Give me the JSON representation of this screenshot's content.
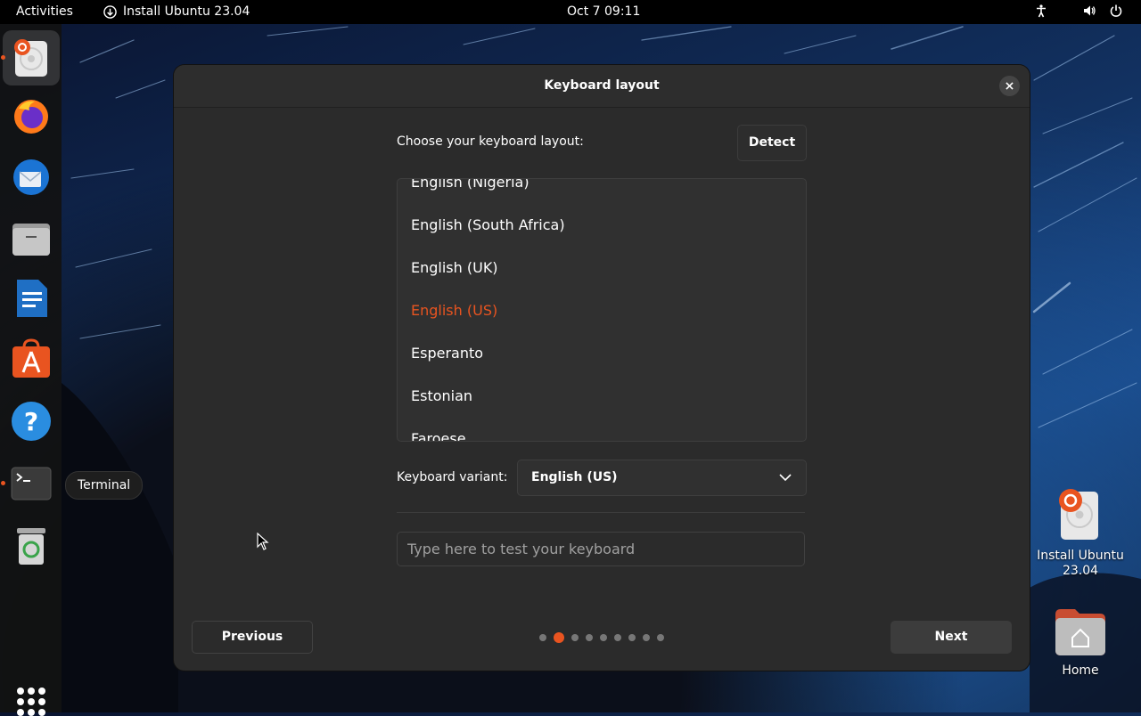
{
  "topbar": {
    "activities": "Activities",
    "app_name": "Install Ubuntu 23.04",
    "clock": "Oct 7  09:11",
    "tray_icons": [
      "accessibility-icon",
      "volume-icon",
      "power-icon"
    ]
  },
  "dock": {
    "items": [
      {
        "name": "ubuntu-installer",
        "running": true,
        "active": true
      },
      {
        "name": "firefox"
      },
      {
        "name": "thunderbird"
      },
      {
        "name": "files"
      },
      {
        "name": "libreoffice-writer"
      },
      {
        "name": "ubuntu-software"
      },
      {
        "name": "help"
      },
      {
        "name": "terminal",
        "running": true
      },
      {
        "name": "trash"
      }
    ],
    "tooltip": "Terminal",
    "show_apps_icon": "apps-grid-icon"
  },
  "dialog": {
    "title": "Keyboard layout",
    "choose_label": "Choose your keyboard layout:",
    "detect_label": "Detect",
    "layouts": [
      "English (Nigeria)",
      "English (South Africa)",
      "English (UK)",
      "English (US)",
      "Esperanto",
      "Estonian",
      "Faroese"
    ],
    "selected_layout": "English (US)",
    "variant_label": "Keyboard variant:",
    "variant_value": "English (US)",
    "test_placeholder": "Type here to test your keyboard",
    "previous_label": "Previous",
    "next_label": "Next",
    "progress": {
      "total": 9,
      "current": 2
    }
  },
  "desktop": {
    "icons": [
      {
        "label_line1": "Install Ubuntu",
        "label_line2": "23.04"
      },
      {
        "label_line1": "Home"
      }
    ]
  },
  "colors": {
    "accent": "#e95420",
    "dialog_bg": "#2b2b2b",
    "topbar_bg": "#000000"
  }
}
